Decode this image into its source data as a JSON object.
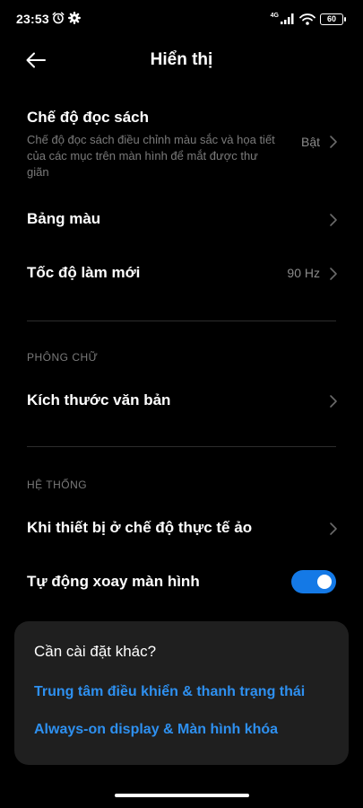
{
  "status_bar": {
    "time": "23:53",
    "network": "4G",
    "battery": "60"
  },
  "header": {
    "title": "Hiển thị",
    "back_icon": "arrow-left-icon"
  },
  "settings": {
    "reading_mode": {
      "title": "Chế độ đọc sách",
      "description": "Chế độ đọc sách điều chỉnh màu sắc và họa tiết của các mục trên màn hình để mắt được thư giãn",
      "value": "Bật"
    },
    "color_palette": {
      "title": "Bảng màu"
    },
    "refresh_rate": {
      "title": "Tốc độ làm mới",
      "value": "90 Hz"
    },
    "font_section": {
      "label": "PHÔNG CHỮ"
    },
    "text_size": {
      "title": "Kích thước văn bản"
    },
    "system_section": {
      "label": "HỆ THỐNG"
    },
    "vr_mode": {
      "title": "Khi thiết bị ở chế độ thực tế ảo"
    },
    "auto_rotate": {
      "title": "Tự động xoay màn hình",
      "enabled": true
    }
  },
  "suggestions": {
    "title": "Cần cài đặt khác?",
    "links": [
      "Trung tâm điều khiển & thanh trạng thái",
      "Always-on display & Màn hình khóa"
    ]
  },
  "colors": {
    "background": "#000000",
    "accent": "#2e90f0",
    "toggle_on": "#1479e6",
    "secondary_text": "#7a7a7a",
    "card_background": "#1f1f1f"
  }
}
